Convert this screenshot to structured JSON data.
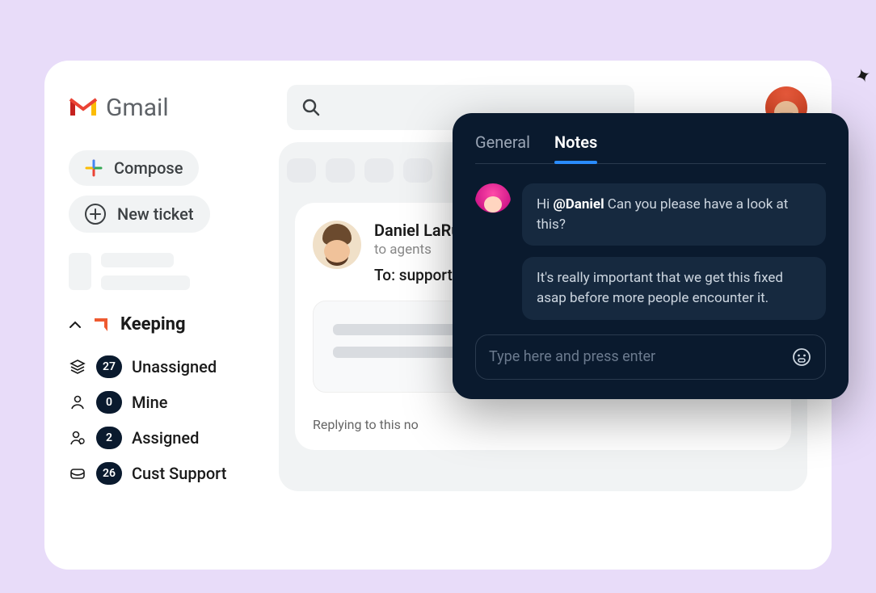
{
  "header": {
    "app_name": "Gmail",
    "search_placeholder": ""
  },
  "sidebar": {
    "compose_label": "Compose",
    "new_ticket_label": "New ticket",
    "section_title": "Keeping",
    "items": [
      {
        "icon": "layers",
        "count": "27",
        "label": "Unassigned"
      },
      {
        "icon": "person",
        "count": "0",
        "label": "Mine"
      },
      {
        "icon": "person-assign",
        "count": "2",
        "label": "Assigned"
      },
      {
        "icon": "inbox",
        "count": "26",
        "label": "Cust Support"
      }
    ]
  },
  "email": {
    "sender_name": "Daniel LaRu",
    "to_agents": "to agents",
    "to_line": "To: support@",
    "reply_hint": "Replying to this no"
  },
  "notes_panel": {
    "tabs": {
      "general": "General",
      "notes": "Notes"
    },
    "messages": [
      {
        "prefix": "Hi ",
        "mention": "@Daniel",
        "rest": " Can you please have a look at this?"
      },
      {
        "text": "It's really important that we get this fixed asap before more people encounter it."
      }
    ],
    "input_placeholder": "Type here and press enter"
  }
}
